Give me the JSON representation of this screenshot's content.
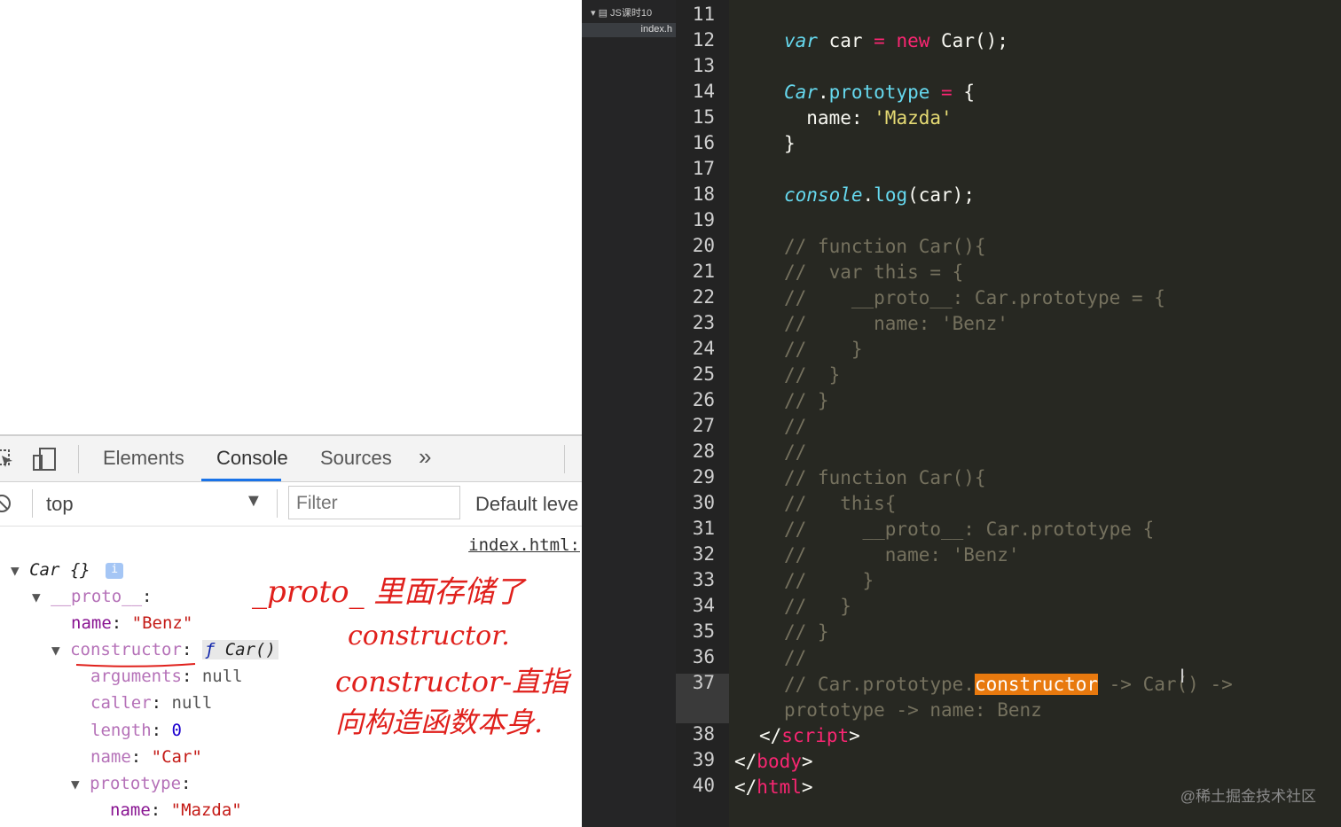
{
  "devtools": {
    "tabs": [
      "Elements",
      "Console",
      "Sources"
    ],
    "more_tabs": "»",
    "context": "top",
    "filter_placeholder": "Filter",
    "levels": "Default leve",
    "source_link": "index.html:"
  },
  "console": {
    "root": "Car {}",
    "root_info": "i",
    "proto_key": "__proto__",
    "name_key": "name",
    "name_val": "\"Benz\"",
    "constructor_key": "constructor",
    "constructor_f": "ƒ",
    "constructor_val": "Car()",
    "arguments_key": "arguments",
    "arguments_val": "null",
    "caller_key": "caller",
    "caller_val": "null",
    "length_key": "length",
    "length_val": "0",
    "fname_key": "name",
    "fname_val": "\"Car\"",
    "prototype_key": "prototype",
    "pname_key": "name",
    "pname_val": "\"Mazda\""
  },
  "annotations": {
    "line1": "_proto_ 里面存储了",
    "line2": "constructor.",
    "line3": "constructor-直指",
    "line4": "向构造函数本身."
  },
  "editor": {
    "folder": "JS课时10",
    "file": "index.h",
    "line_numbers": [
      "11",
      "12",
      "13",
      "14",
      "15",
      "16",
      "17",
      "18",
      "19",
      "20",
      "21",
      "22",
      "23",
      "24",
      "25",
      "26",
      "27",
      "28",
      "29",
      "30",
      "31",
      "32",
      "33",
      "34",
      "35",
      "36",
      "37",
      "",
      "38",
      "39",
      "40"
    ],
    "code": {
      "l12_var": "var",
      "l12_mid": " car ",
      "l12_eq": "=",
      "l12_new": " new ",
      "l12_end": "Car();",
      "l14_car": "Car",
      "l14_dot": ".",
      "l14_proto": "prototype",
      "l14_eq": " = ",
      "l14_end": "{",
      "l15_key": "  name: ",
      "l15_val": "'Mazda'",
      "l16": "}",
      "l18_console": "console",
      "l18_dot": ".",
      "l18_log": "log",
      "l18_end": "(car);",
      "l20": "// function Car(){",
      "l21": "//  var this = {",
      "l22": "//    __proto__: Car.prototype = {",
      "l23": "//      name: 'Benz'",
      "l24": "//    }",
      "l25": "//  }",
      "l26": "// }",
      "l27": "//",
      "l28": "//",
      "l29": "// function Car(){",
      "l30": "//   this{",
      "l31": "//     __proto__: Car.prototype {",
      "l32": "//       name: 'Benz'",
      "l33": "//     }",
      "l34": "//   }",
      "l35": "// }",
      "l36": "//",
      "l37_pre": "// Car.prototype.",
      "l37_hl": "constructor",
      "l37_post": " -> Car() ->",
      "l37b": "prototype -> name: Benz",
      "l38_open": "</",
      "l38_tag": "script",
      "l38_close": ">",
      "l39_open": "</",
      "l39_tag": "body",
      "l39_close": ">",
      "l40_open": "</",
      "l40_tag": "html",
      "l40_close": ">"
    }
  },
  "watermark": "@稀土掘金技术社区"
}
